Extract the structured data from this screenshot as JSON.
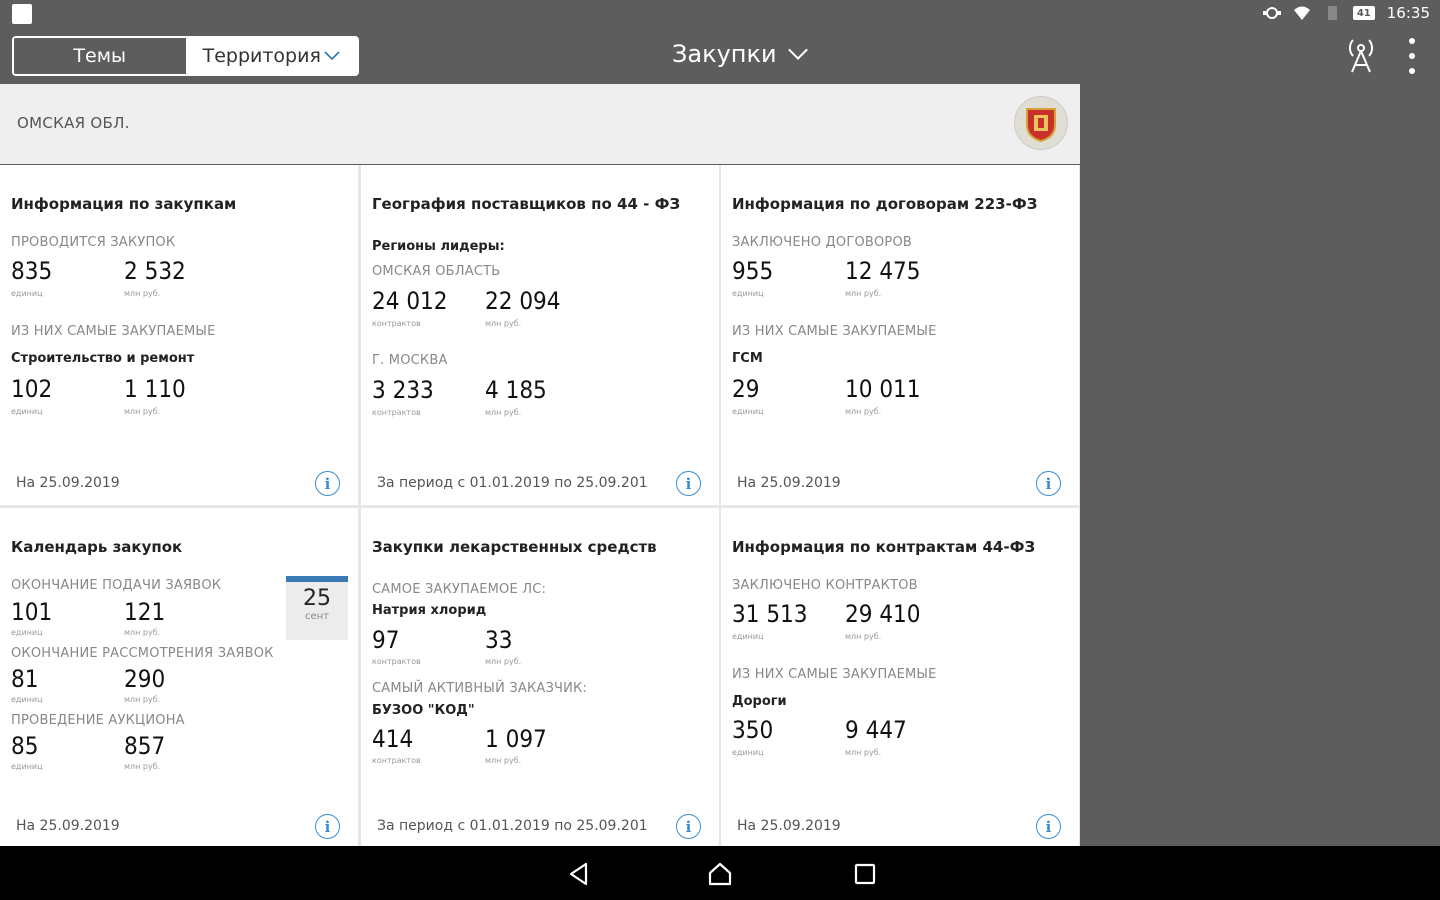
{
  "status": {
    "battery": "41",
    "time": "16:35"
  },
  "tabs": [
    {
      "label": "Темы",
      "active": true
    },
    {
      "label": "Территория",
      "active": false
    }
  ],
  "title": "Закупки",
  "region": {
    "name": "ОМСКАЯ ОБЛ."
  },
  "cards": {
    "c1": {
      "title": "Информация по закупкам",
      "label1": "ПРОВОДИТСЯ ЗАКУПОК",
      "v1a": "835",
      "u1a": "единиц",
      "v1b": "2 532",
      "u1b": "млн руб.",
      "label2": "ИЗ НИХ САМЫЕ ЗАКУПАЕМЫЕ",
      "sub2": "Строительство и ремонт",
      "v2a": "102",
      "u2a": "единиц",
      "v2b": "1 110",
      "u2b": "млн руб.",
      "footer": "На 25.09.2019"
    },
    "c2": {
      "title": "География поставщиков по 44 - ФЗ",
      "sub0": "Регионы лидеры:",
      "label1": "ОМСКАЯ ОБЛАСТЬ",
      "v1a": "24 012",
      "u1a": "контрактов",
      "v1b": "22 094",
      "u1b": "млн руб.",
      "label2": "Г. МОСКВА",
      "v2a": "3 233",
      "u2a": "контрактов",
      "v2b": "4 185",
      "u2b": "млн руб.",
      "footer": "За период с 01.01.2019 по 25.09.201"
    },
    "c3": {
      "title": "Информация по договорам 223-ФЗ",
      "label1": "ЗАКЛЮЧЕНО ДОГОВОРОВ",
      "v1a": "955",
      "u1a": "единиц",
      "v1b": "12 475",
      "u1b": "млн руб.",
      "label2": "ИЗ НИХ САМЫЕ ЗАКУПАЕМЫЕ",
      "sub2": "ГСМ",
      "v2a": "29",
      "u2a": "единиц",
      "v2b": "10 011",
      "u2b": "млн руб.",
      "footer": "На 25.09.2019"
    },
    "c4": {
      "title": "Календарь закупок",
      "label1": "ОКОНЧАНИЕ ПОДАЧИ ЗАЯВОК",
      "v1a": "101",
      "u1a": "единиц",
      "v1b": "121",
      "u1b": "млн руб.",
      "label2": "ОКОНЧАНИЕ РАССМОТРЕНИЯ ЗАЯВОК",
      "v2a": "81",
      "u2a": "единиц",
      "v2b": "290",
      "u2b": "млн руб.",
      "label3": "ПРОВЕДЕНИЕ АУКЦИОНА",
      "v3a": "85",
      "u3a": "единиц",
      "v3b": "857",
      "u3b": "млн руб.",
      "cal_day": "25",
      "cal_month": "сент",
      "footer": "На 25.09.2019"
    },
    "c5": {
      "title": "Закупки лекарственных средств",
      "label1": "САМОЕ ЗАКУПАЕМОЕ ЛС:",
      "sub1": "Натрия хлорид",
      "v1a": "97",
      "u1a": "контрактов",
      "v1b": "33",
      "u1b": "млн руб.",
      "label2": "САМЫЙ АКТИВНЫЙ ЗАКАЗЧИК:",
      "sub2": "БУЗОО \"КОД\"",
      "v2a": "414",
      "u2a": "контрактов",
      "v2b": "1 097",
      "u2b": "млн руб.",
      "footer": "За период с 01.01.2019 по 25.09.201"
    },
    "c6": {
      "title": "Информация по контрактам 44-ФЗ",
      "label1": "ЗАКЛЮЧЕНО КОНТРАКТОВ",
      "v1a": "31 513",
      "u1a": "единиц",
      "v1b": "29 410",
      "u1b": "млн руб.",
      "label2": "ИЗ НИХ САМЫЕ ЗАКУПАЕМЫЕ",
      "sub2": "Дороги",
      "v2a": "350",
      "u2a": "единиц",
      "v2b": "9 447",
      "u2b": "млн руб.",
      "footer": "На 25.09.2019"
    }
  },
  "colors": {
    "accent": "#3a8dd0",
    "chrome": "#5d5d5d"
  }
}
